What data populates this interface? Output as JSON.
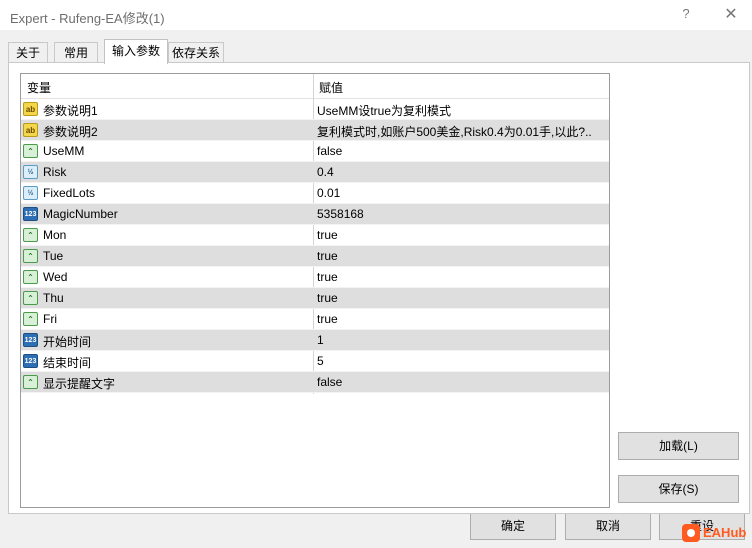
{
  "window": {
    "title": "Expert - Rufeng-EA修改(1)",
    "help": "?",
    "close": "✕"
  },
  "tabs": [
    {
      "label": "关于"
    },
    {
      "label": "常用"
    },
    {
      "label": "输入参数"
    },
    {
      "label": "依存关系"
    }
  ],
  "grid": {
    "headers": {
      "variable": "变量",
      "value": "赋值"
    },
    "rows": [
      {
        "name": "参数说明1",
        "value": "UseMM设true为复利模式",
        "icon": "text-icon"
      },
      {
        "name": "参数说明2",
        "value": "复利模式时,如账户500美金,Risk0.4为0.01手,以此?..",
        "icon": "text-icon"
      },
      {
        "name": "UseMM",
        "value": "false",
        "icon": "bool-icon"
      },
      {
        "name": "Risk",
        "value": "0.4",
        "icon": "double-icon"
      },
      {
        "name": "FixedLots",
        "value": "0.01",
        "icon": "double-icon"
      },
      {
        "name": "MagicNumber",
        "value": "5358168",
        "icon": "int-icon"
      },
      {
        "name": "Mon",
        "value": "true",
        "icon": "bool-icon"
      },
      {
        "name": "Tue",
        "value": "true",
        "icon": "bool-icon"
      },
      {
        "name": "Wed",
        "value": "true",
        "icon": "bool-icon"
      },
      {
        "name": "Thu",
        "value": "true",
        "icon": "bool-icon"
      },
      {
        "name": "Fri",
        "value": "true",
        "icon": "bool-icon"
      },
      {
        "name": "开始时间",
        "value": "1",
        "icon": "int-icon"
      },
      {
        "name": "结束时间",
        "value": "5",
        "icon": "int-icon"
      },
      {
        "name": "显示提醒文字",
        "value": "false",
        "icon": "bool-icon"
      }
    ]
  },
  "icon_glyphs": {
    "text": "ab",
    "bool": "⌃",
    "double": "½",
    "int": "123"
  },
  "buttons": {
    "load": "加载(L)",
    "save": "保存(S)",
    "ok": "确定",
    "cancel": "取消",
    "reset": "重设"
  },
  "watermark": {
    "text": "EAHub"
  }
}
